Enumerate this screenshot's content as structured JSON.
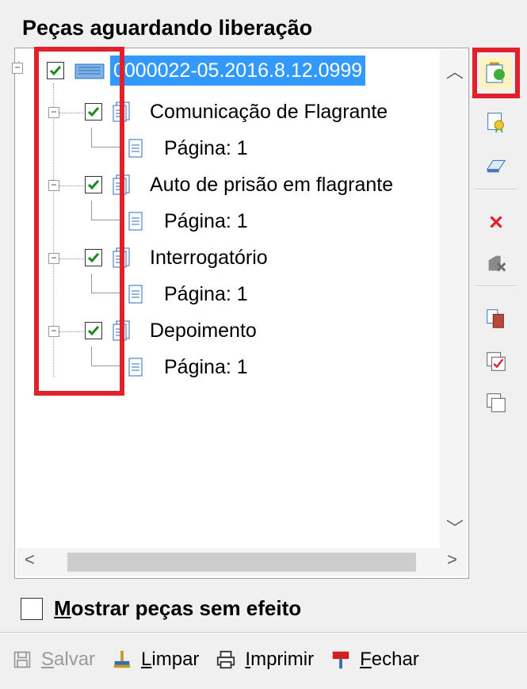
{
  "panel": {
    "title": "Peças aguardando liberação"
  },
  "tree": {
    "root": {
      "label": "0000022-05.2016.8.12.0999",
      "checked": true
    },
    "documents": [
      {
        "label": "Comunicação de Flagrante",
        "checked": true,
        "page": "Página: 1"
      },
      {
        "label": "Auto de prisão em flagrante",
        "checked": true,
        "page": "Página: 1"
      },
      {
        "label": "Interrogatório",
        "checked": true,
        "page": "Página: 1"
      },
      {
        "label": "Depoimento",
        "checked": true,
        "page": "Página: 1"
      }
    ]
  },
  "side_toolbar": {
    "icons": [
      "release-peca-icon",
      "certificate-icon",
      "eraser-icon",
      "delete-icon",
      "remove-icon",
      "copy-icon",
      "check-all-icon",
      "uncheck-all-icon"
    ]
  },
  "options": {
    "show_without_effect": "Mostrar peças sem efeito",
    "show_without_effect_checked": false
  },
  "bottom_toolbar": {
    "save": "Salvar",
    "clear": "Limpar",
    "print": "Imprimir",
    "close": "Fechar"
  },
  "colors": {
    "highlight": "#3399ff",
    "annotation": "#e0202a",
    "check": "#1a8a1a"
  }
}
